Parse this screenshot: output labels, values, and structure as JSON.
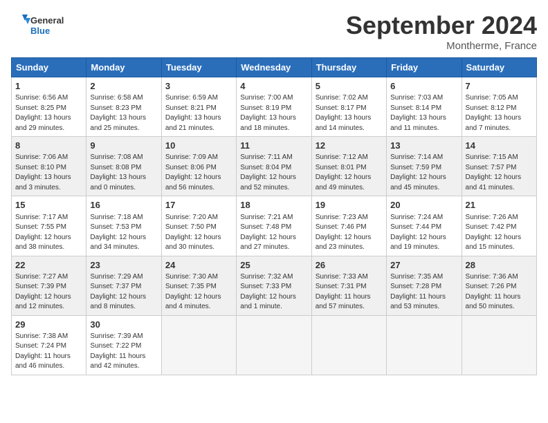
{
  "header": {
    "logo_line1": "General",
    "logo_line2": "Blue",
    "month": "September 2024",
    "location": "Montherme, France"
  },
  "days_of_week": [
    "Sunday",
    "Monday",
    "Tuesday",
    "Wednesday",
    "Thursday",
    "Friday",
    "Saturday"
  ],
  "weeks": [
    [
      {
        "day": "1",
        "lines": [
          "Sunrise: 6:56 AM",
          "Sunset: 8:25 PM",
          "Daylight: 13 hours",
          "and 29 minutes."
        ]
      },
      {
        "day": "2",
        "lines": [
          "Sunrise: 6:58 AM",
          "Sunset: 8:23 PM",
          "Daylight: 13 hours",
          "and 25 minutes."
        ]
      },
      {
        "day": "3",
        "lines": [
          "Sunrise: 6:59 AM",
          "Sunset: 8:21 PM",
          "Daylight: 13 hours",
          "and 21 minutes."
        ]
      },
      {
        "day": "4",
        "lines": [
          "Sunrise: 7:00 AM",
          "Sunset: 8:19 PM",
          "Daylight: 13 hours",
          "and 18 minutes."
        ]
      },
      {
        "day": "5",
        "lines": [
          "Sunrise: 7:02 AM",
          "Sunset: 8:17 PM",
          "Daylight: 13 hours",
          "and 14 minutes."
        ]
      },
      {
        "day": "6",
        "lines": [
          "Sunrise: 7:03 AM",
          "Sunset: 8:14 PM",
          "Daylight: 13 hours",
          "and 11 minutes."
        ]
      },
      {
        "day": "7",
        "lines": [
          "Sunrise: 7:05 AM",
          "Sunset: 8:12 PM",
          "Daylight: 13 hours",
          "and 7 minutes."
        ]
      }
    ],
    [
      {
        "day": "8",
        "lines": [
          "Sunrise: 7:06 AM",
          "Sunset: 8:10 PM",
          "Daylight: 13 hours",
          "and 3 minutes."
        ]
      },
      {
        "day": "9",
        "lines": [
          "Sunrise: 7:08 AM",
          "Sunset: 8:08 PM",
          "Daylight: 13 hours",
          "and 0 minutes."
        ]
      },
      {
        "day": "10",
        "lines": [
          "Sunrise: 7:09 AM",
          "Sunset: 8:06 PM",
          "Daylight: 12 hours",
          "and 56 minutes."
        ]
      },
      {
        "day": "11",
        "lines": [
          "Sunrise: 7:11 AM",
          "Sunset: 8:04 PM",
          "Daylight: 12 hours",
          "and 52 minutes."
        ]
      },
      {
        "day": "12",
        "lines": [
          "Sunrise: 7:12 AM",
          "Sunset: 8:01 PM",
          "Daylight: 12 hours",
          "and 49 minutes."
        ]
      },
      {
        "day": "13",
        "lines": [
          "Sunrise: 7:14 AM",
          "Sunset: 7:59 PM",
          "Daylight: 12 hours",
          "and 45 minutes."
        ]
      },
      {
        "day": "14",
        "lines": [
          "Sunrise: 7:15 AM",
          "Sunset: 7:57 PM",
          "Daylight: 12 hours",
          "and 41 minutes."
        ]
      }
    ],
    [
      {
        "day": "15",
        "lines": [
          "Sunrise: 7:17 AM",
          "Sunset: 7:55 PM",
          "Daylight: 12 hours",
          "and 38 minutes."
        ]
      },
      {
        "day": "16",
        "lines": [
          "Sunrise: 7:18 AM",
          "Sunset: 7:53 PM",
          "Daylight: 12 hours",
          "and 34 minutes."
        ]
      },
      {
        "day": "17",
        "lines": [
          "Sunrise: 7:20 AM",
          "Sunset: 7:50 PM",
          "Daylight: 12 hours",
          "and 30 minutes."
        ]
      },
      {
        "day": "18",
        "lines": [
          "Sunrise: 7:21 AM",
          "Sunset: 7:48 PM",
          "Daylight: 12 hours",
          "and 27 minutes."
        ]
      },
      {
        "day": "19",
        "lines": [
          "Sunrise: 7:23 AM",
          "Sunset: 7:46 PM",
          "Daylight: 12 hours",
          "and 23 minutes."
        ]
      },
      {
        "day": "20",
        "lines": [
          "Sunrise: 7:24 AM",
          "Sunset: 7:44 PM",
          "Daylight: 12 hours",
          "and 19 minutes."
        ]
      },
      {
        "day": "21",
        "lines": [
          "Sunrise: 7:26 AM",
          "Sunset: 7:42 PM",
          "Daylight: 12 hours",
          "and 15 minutes."
        ]
      }
    ],
    [
      {
        "day": "22",
        "lines": [
          "Sunrise: 7:27 AM",
          "Sunset: 7:39 PM",
          "Daylight: 12 hours",
          "and 12 minutes."
        ]
      },
      {
        "day": "23",
        "lines": [
          "Sunrise: 7:29 AM",
          "Sunset: 7:37 PM",
          "Daylight: 12 hours",
          "and 8 minutes."
        ]
      },
      {
        "day": "24",
        "lines": [
          "Sunrise: 7:30 AM",
          "Sunset: 7:35 PM",
          "Daylight: 12 hours",
          "and 4 minutes."
        ]
      },
      {
        "day": "25",
        "lines": [
          "Sunrise: 7:32 AM",
          "Sunset: 7:33 PM",
          "Daylight: 12 hours",
          "and 1 minute."
        ]
      },
      {
        "day": "26",
        "lines": [
          "Sunrise: 7:33 AM",
          "Sunset: 7:31 PM",
          "Daylight: 11 hours",
          "and 57 minutes."
        ]
      },
      {
        "day": "27",
        "lines": [
          "Sunrise: 7:35 AM",
          "Sunset: 7:28 PM",
          "Daylight: 11 hours",
          "and 53 minutes."
        ]
      },
      {
        "day": "28",
        "lines": [
          "Sunrise: 7:36 AM",
          "Sunset: 7:26 PM",
          "Daylight: 11 hours",
          "and 50 minutes."
        ]
      }
    ],
    [
      {
        "day": "29",
        "lines": [
          "Sunrise: 7:38 AM",
          "Sunset: 7:24 PM",
          "Daylight: 11 hours",
          "and 46 minutes."
        ]
      },
      {
        "day": "30",
        "lines": [
          "Sunrise: 7:39 AM",
          "Sunset: 7:22 PM",
          "Daylight: 11 hours",
          "and 42 minutes."
        ]
      },
      {
        "day": "",
        "lines": []
      },
      {
        "day": "",
        "lines": []
      },
      {
        "day": "",
        "lines": []
      },
      {
        "day": "",
        "lines": []
      },
      {
        "day": "",
        "lines": []
      }
    ]
  ]
}
